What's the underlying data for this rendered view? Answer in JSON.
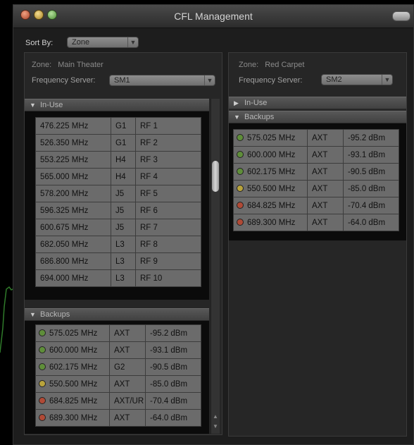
{
  "window": {
    "title": "CFL Management"
  },
  "sort": {
    "label": "Sort By:",
    "value": "Zone"
  },
  "zones": [
    {
      "zone_label": "Zone:",
      "zone_name": "Main Theater",
      "server_label": "Frequency Server:",
      "server_value": "SM1",
      "inuse_label": "In-Use",
      "inuse_expanded": true,
      "inuse_rows": [
        {
          "freq": "476.225 MHz",
          "group": "G1",
          "channel": "RF 1"
        },
        {
          "freq": "526.350 MHz",
          "group": "G1",
          "channel": "RF 2"
        },
        {
          "freq": "553.225 MHz",
          "group": "H4",
          "channel": "RF 3"
        },
        {
          "freq": "565.000 MHz",
          "group": "H4",
          "channel": "RF 4"
        },
        {
          "freq": "578.200 MHz",
          "group": "J5",
          "channel": "RF 5"
        },
        {
          "freq": "596.325 MHz",
          "group": "J5",
          "channel": "RF 6"
        },
        {
          "freq": "600.675 MHz",
          "group": "J5",
          "channel": "RF 7"
        },
        {
          "freq": "682.050 MHz",
          "group": "L3",
          "channel": "RF 8"
        },
        {
          "freq": "686.800 MHz",
          "group": "L3",
          "channel": "RF 9"
        },
        {
          "freq": "694.000 MHz",
          "group": "L3",
          "channel": "RF 10"
        }
      ],
      "backups_label": "Backups",
      "backup_rows": [
        {
          "status": "green",
          "freq": "575.025 MHz",
          "group": "AXT",
          "level": "-95.2 dBm"
        },
        {
          "status": "green",
          "freq": "600.000 MHz",
          "group": "AXT",
          "level": "-93.1 dBm"
        },
        {
          "status": "green",
          "freq": "602.175 MHz",
          "group": "G2",
          "level": "-90.5 dBm"
        },
        {
          "status": "yellow",
          "freq": "550.500 MHz",
          "group": "AXT",
          "level": "-85.0 dBm"
        },
        {
          "status": "red",
          "freq": "684.825 MHz",
          "group": "AXT/UR",
          "level": "-70.4 dBm"
        },
        {
          "status": "red",
          "freq": "689.300 MHz",
          "group": "AXT",
          "level": "-64.0 dBm"
        }
      ]
    },
    {
      "zone_label": "Zone:",
      "zone_name": "Red Carpet",
      "server_label": "Frequency Server:",
      "server_value": "SM2",
      "inuse_label": "In-Use",
      "inuse_expanded": false,
      "backups_label": "Backups",
      "backup_rows": [
        {
          "status": "green",
          "freq": "575.025 MHz",
          "group": "AXT",
          "level": "-95.2 dBm"
        },
        {
          "status": "green",
          "freq": "600.000 MHz",
          "group": "AXT",
          "level": "-93.1 dBm"
        },
        {
          "status": "green",
          "freq": "602.175 MHz",
          "group": "AXT",
          "level": "-90.5 dBm"
        },
        {
          "status": "yellow",
          "freq": "550.500 MHz",
          "group": "AXT",
          "level": "-85.0 dBm"
        },
        {
          "status": "red",
          "freq": "684.825 MHz",
          "group": "AXT",
          "level": "-70.4 dBm"
        },
        {
          "status": "red",
          "freq": "689.300 MHz",
          "group": "AXT",
          "level": "-64.0 dBm"
        }
      ]
    }
  ],
  "colors": {
    "status_green": "#5f8e3a",
    "status_yellow": "#b9a43c",
    "status_red": "#b04a36"
  },
  "icons": {
    "close": "close-icon",
    "minimize": "minimize-icon",
    "zoom": "zoom-icon",
    "expand": "triangle-down-icon",
    "collapse": "triangle-right-icon",
    "status": "status-dot-icon"
  }
}
